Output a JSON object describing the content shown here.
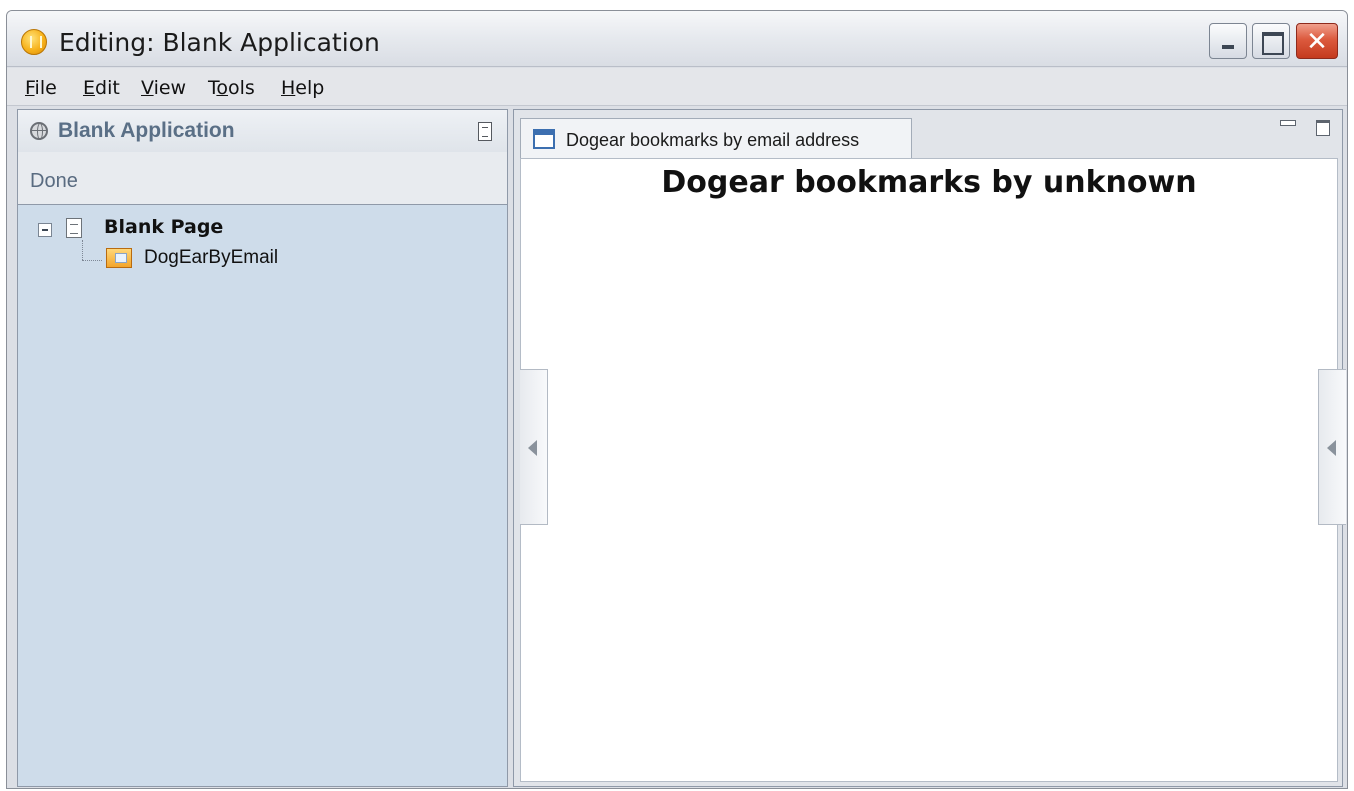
{
  "window": {
    "title": "Editing: Blank Application"
  },
  "menubar": {
    "items": [
      {
        "pre": "",
        "u": "F",
        "post": "ile"
      },
      {
        "pre": "",
        "u": "E",
        "post": "dit"
      },
      {
        "pre": "",
        "u": "V",
        "post": "iew"
      },
      {
        "pre": "T",
        "u": "o",
        "post": "ols"
      },
      {
        "pre": "",
        "u": "H",
        "post": "elp"
      }
    ]
  },
  "left_panel": {
    "title": "Blank Application",
    "status": "Done",
    "tree": {
      "page_label": "Blank Page",
      "portlet_label": "DogEarByEmail"
    },
    "icons": {
      "header": "globe-icon",
      "menu": "panel-menu-icon",
      "page": "page-icon",
      "portlet": "portlet-icon"
    }
  },
  "right_panel": {
    "tab_label": "Dogear bookmarks by email address",
    "content_heading": "Dogear bookmarks by unknown"
  }
}
